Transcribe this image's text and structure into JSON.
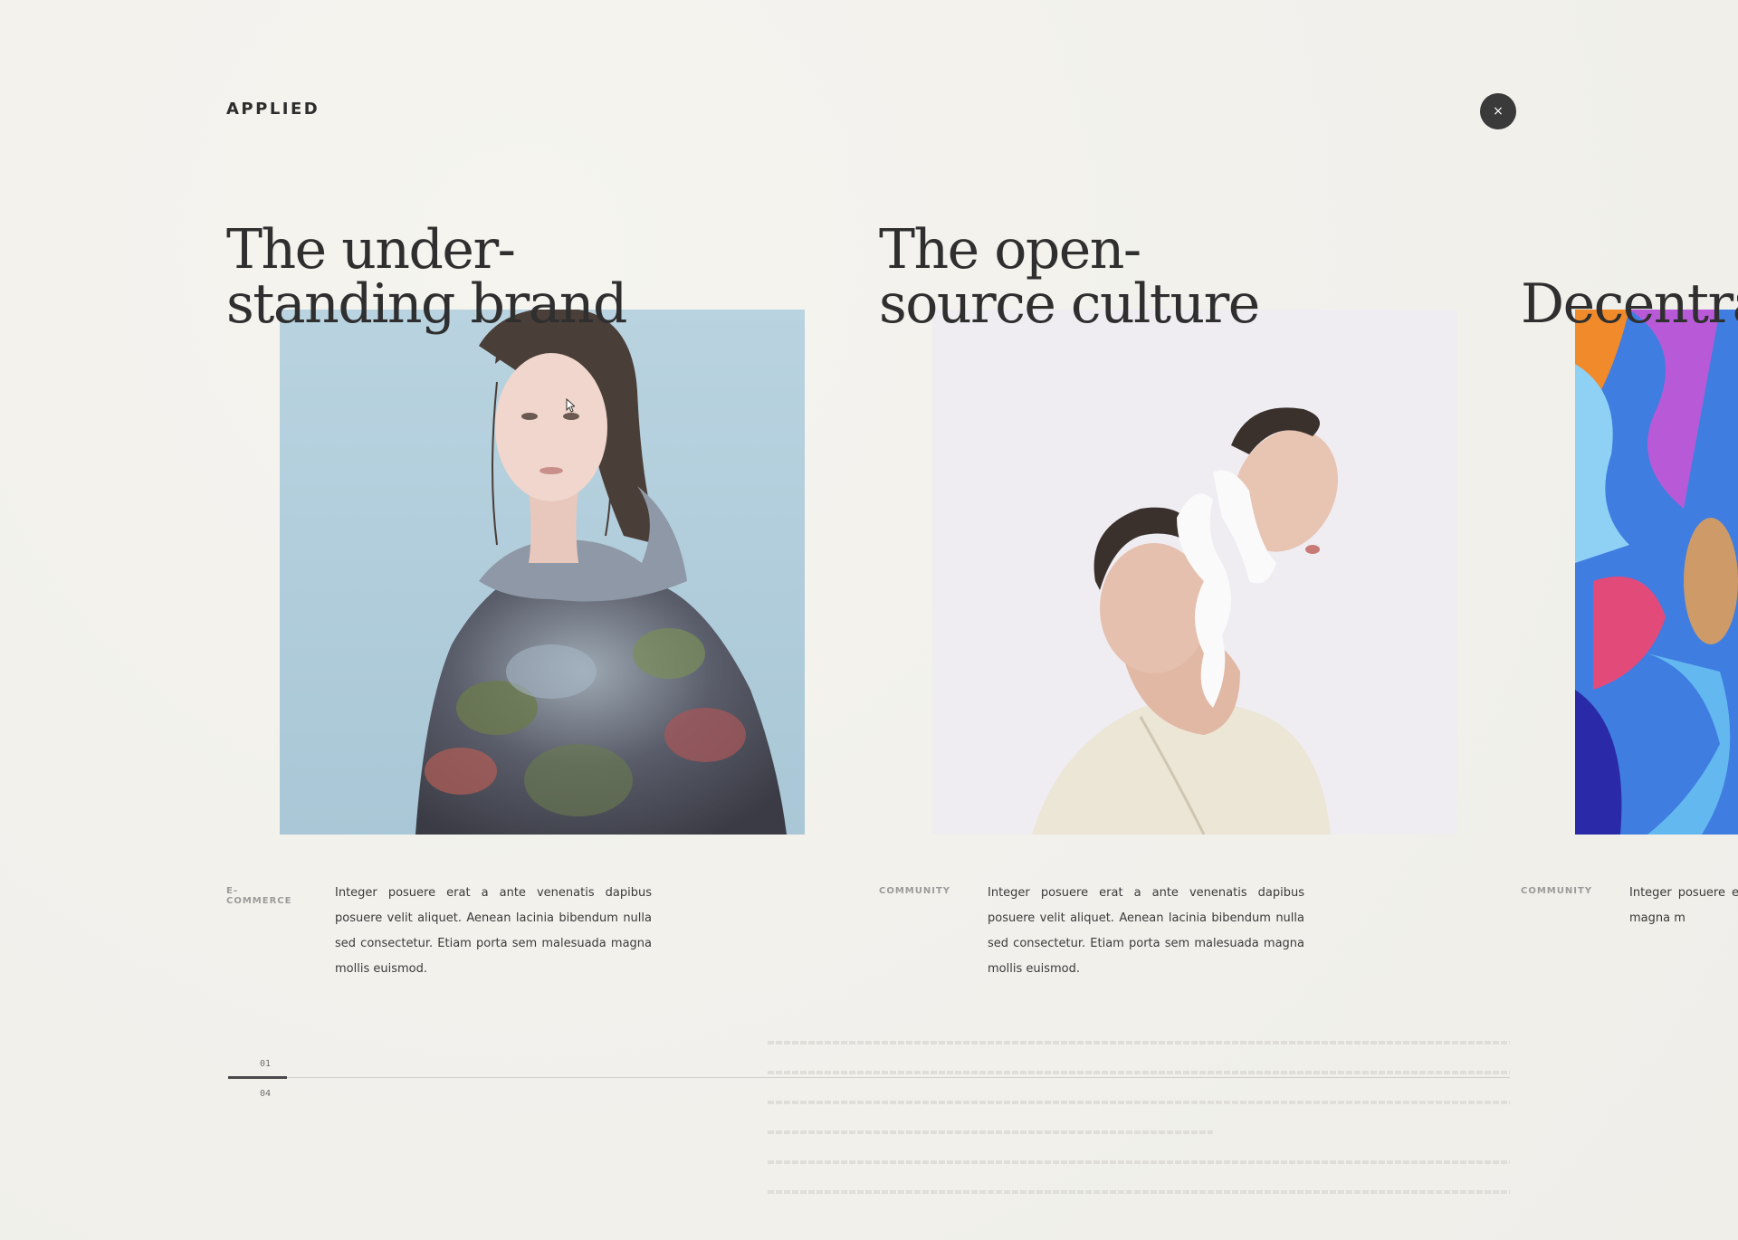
{
  "header": {
    "logo": "APPLIED",
    "close_label": "×"
  },
  "cards": [
    {
      "title_lines": [
        "The under-",
        "standing brand"
      ],
      "tag": "E-COMMERCE",
      "description": "Integer posuere erat a ante venenatis dapibus posuere velit aliquet. Aenean lacinia bibendum nulla sed consectetur. Etiam porta sem malesuada magna mollis euismod."
    },
    {
      "title_lines": [
        "The open-",
        "source culture"
      ],
      "tag": "COMMUNITY",
      "description": "Integer posuere erat a ante venenatis dapibus posuere velit aliquet. Aenean lacinia bibendum nulla sed consectetur. Etiam porta sem malesuada magna mollis euismod."
    },
    {
      "title_lines": [
        "",
        "Decentral"
      ],
      "tag": "COMMUNITY",
      "description": "Integer posuere erat Aenean lacinia bib malesuada magna m"
    }
  ],
  "pager": {
    "current": "01",
    "total": "04",
    "progress": 0.046
  },
  "colors": {
    "background": "#f3f2ed",
    "text": "#2f2f2f",
    "close_button": "#3a3a3a",
    "tag": "#9b9b9b"
  },
  "icons": {
    "close": "close-icon"
  }
}
